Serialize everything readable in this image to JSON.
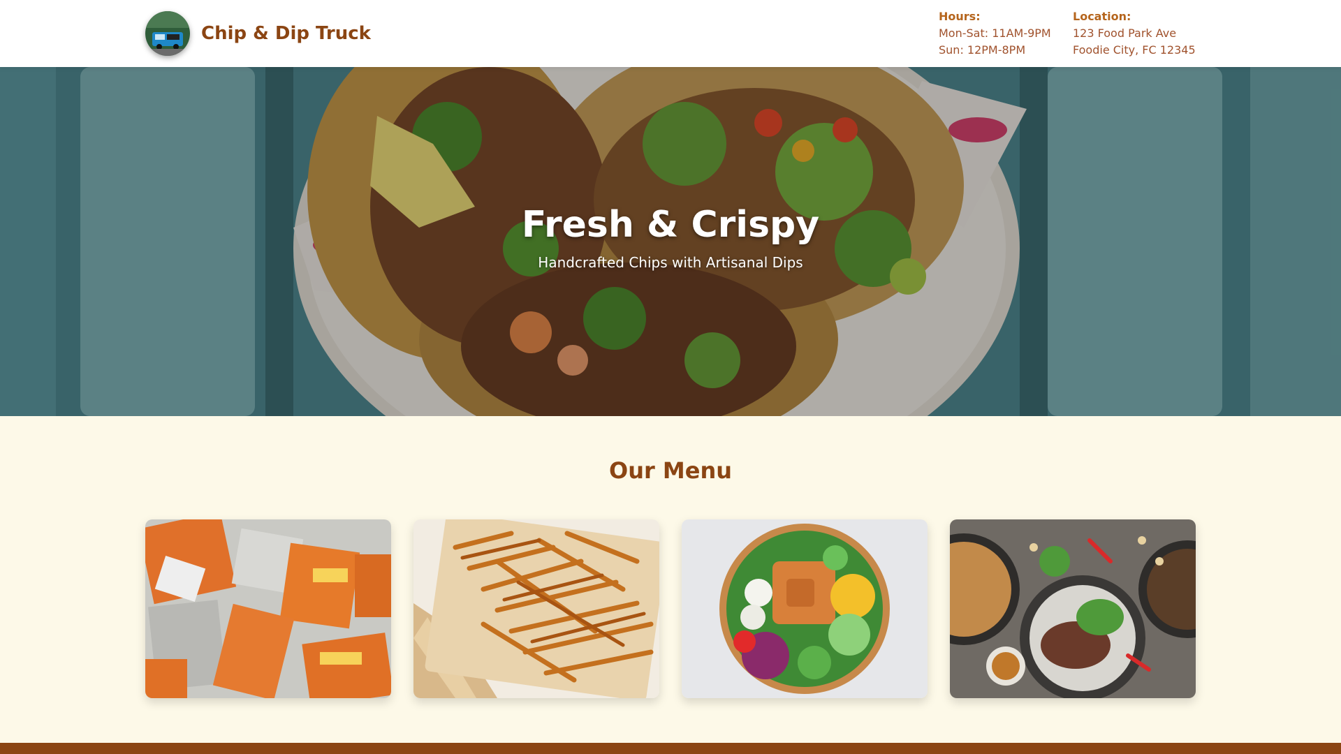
{
  "header": {
    "brand": "Chip & Dip Truck",
    "logo_icon": "food-truck-icon",
    "hours": {
      "label": "Hours:",
      "line1": "Mon-Sat: 11AM-9PM",
      "line2": "Sun: 12PM-8PM"
    },
    "location": {
      "label": "Location:",
      "line1": "123 Food Park Ave",
      "line2": "Foodie City, FC 12345"
    }
  },
  "hero": {
    "title": "Fresh & Crispy",
    "subtitle": "Handcrafted Chips with Artisanal Dips"
  },
  "menu": {
    "title": "Our Menu",
    "items": [
      {
        "image": "chips-bags-photo"
      },
      {
        "image": "french-fries-photo"
      },
      {
        "image": "salad-bowl-photo"
      },
      {
        "image": "plated-dishes-photo"
      }
    ]
  },
  "colors": {
    "brand": "#8b4513",
    "accent": "#b5651d",
    "background": "#fdf9e8",
    "footer": "#8b4513"
  }
}
